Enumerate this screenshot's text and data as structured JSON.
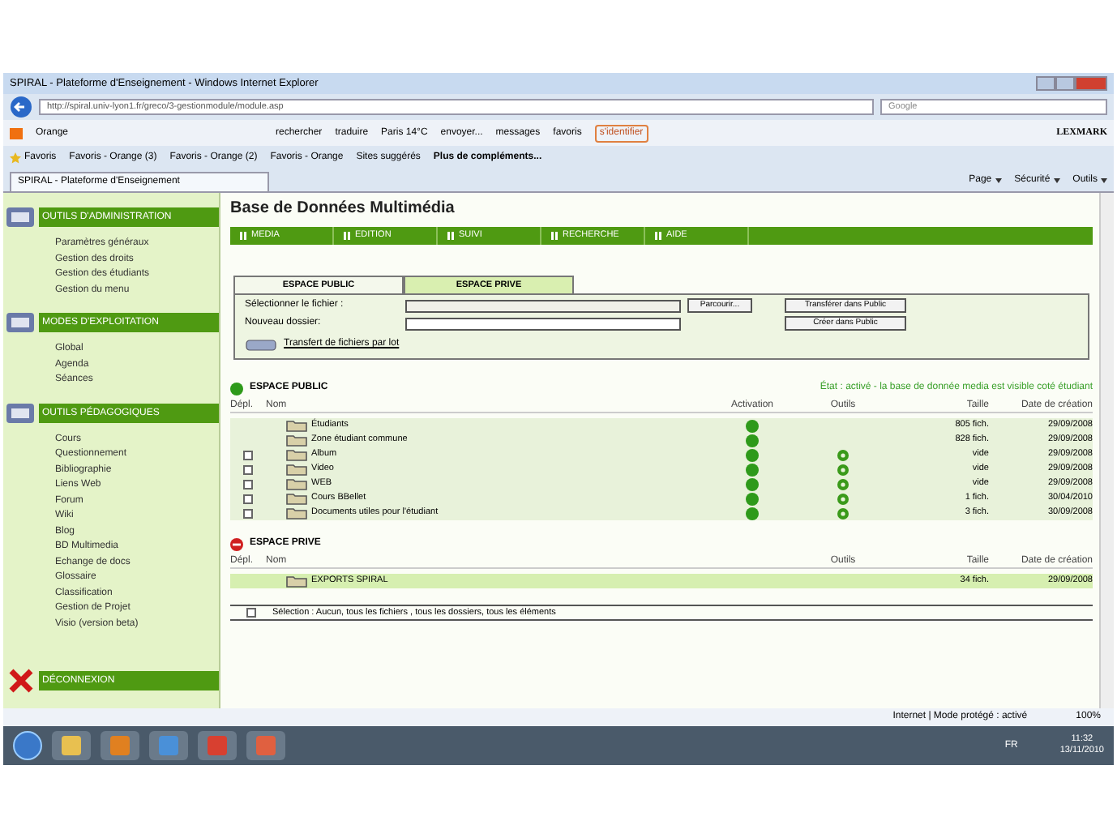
{
  "window": {
    "title": "SPIRAL - Plateforme d'Enseignement - Windows Internet Explorer"
  },
  "address_bar": {
    "url": "http://spiral.univ-lyon1.fr/greco/3-gestionmodule/module.asp",
    "search_placeholder": "Google"
  },
  "toolbar": {
    "brand": "Orange",
    "items": [
      "rechercher",
      "traduire",
      "Paris 14°C",
      "envoyer...",
      "messages",
      "favoris"
    ],
    "login": "s'identifier",
    "right_brand": "LEXMARK"
  },
  "favorites_bar": {
    "label": "Favoris",
    "items": [
      "Favoris - Orange (3)",
      "Favoris - Orange (2)",
      "Favoris - Orange",
      "Sites suggérés",
      "Plus de compléments..."
    ]
  },
  "browser_tab": {
    "title": "SPIRAL - Plateforme d'Enseignement"
  },
  "command_bar": [
    "Page",
    "Sécurité",
    "Outils"
  ],
  "sidebar": {
    "sections": [
      {
        "title": "OUTILS D'ADMINISTRATION",
        "items": [
          "Paramètres généraux",
          "Gestion des droits",
          "Gestion des étudiants",
          "Gestion du menu"
        ]
      },
      {
        "title": "MODES D'EXPLOITATION",
        "items": [
          "Global",
          "Agenda",
          "Séances"
        ]
      },
      {
        "title": "OUTILS PÉDAGOGIQUES",
        "items": [
          "Cours",
          "Questionnement",
          "Bibliographie",
          "Liens Web",
          "Forum",
          "Wiki",
          "Blog",
          "BD Multimedia",
          "Echange de docs",
          "Glossaire",
          "Classification",
          "Gestion de Projet",
          "Visio (version beta)"
        ]
      }
    ],
    "logout": "DÉCONNEXION"
  },
  "page": {
    "title": "Base de Données Multimédia",
    "menu": [
      "MEDIA",
      "EDITION",
      "SUIVI",
      "RECHERCHE",
      "AIDE"
    ]
  },
  "upload": {
    "tabs": [
      {
        "label": "ESPACE PUBLIC",
        "selected": true
      },
      {
        "label": "ESPACE PRIVE",
        "selected": false
      }
    ],
    "file_label": "Sélectionner le fichier :",
    "browse": "Parcourir...",
    "transfer": "Transférer dans Public",
    "folder_label": "Nouveau dossier:",
    "create": "Créer dans Public",
    "batch_link": "Transfert de fichiers par lot"
  },
  "public_space": {
    "title": "ESPACE PUBLIC",
    "state": "État : activé - la base de donnée media est visible coté étudiant",
    "columns": [
      "Dépl.",
      "Nom",
      "Activation",
      "Outils",
      "Taille",
      "Date de création"
    ],
    "rows": [
      {
        "movable": false,
        "name": "Étudiants",
        "active": true,
        "tools": false,
        "size": "805 fich.",
        "date": "29/09/2008"
      },
      {
        "movable": false,
        "name": "Zone étudiant commune",
        "active": true,
        "tools": false,
        "size": "828 fich.",
        "date": "29/09/2008"
      },
      {
        "movable": true,
        "name": "Album",
        "active": true,
        "tools": true,
        "size": "vide",
        "date": "29/09/2008"
      },
      {
        "movable": true,
        "name": "Video",
        "active": true,
        "tools": true,
        "size": "vide",
        "date": "29/09/2008"
      },
      {
        "movable": true,
        "name": "WEB",
        "active": true,
        "tools": true,
        "size": "vide",
        "date": "29/09/2008"
      },
      {
        "movable": true,
        "name": "Cours BBellet",
        "active": true,
        "tools": true,
        "size": "1 fich.",
        "date": "30/04/2010"
      },
      {
        "movable": true,
        "name": "Documents utiles pour l'étudiant",
        "active": true,
        "tools": true,
        "size": "3 fich.",
        "date": "30/09/2008"
      }
    ]
  },
  "private_space": {
    "title": "ESPACE PRIVE",
    "columns": [
      "Dépl.",
      "Nom",
      "Outils",
      "Taille",
      "Date de création"
    ],
    "rows": [
      {
        "name": "EXPORTS SPIRAL",
        "size": "34 fich.",
        "date": "29/09/2008"
      }
    ]
  },
  "selection": {
    "checked": false,
    "label": "Sélection",
    "options": ": Aucun, tous les fichiers , tous les dossiers, tous les éléments"
  },
  "status_bar": {
    "zone": "Internet | Mode protégé : activé",
    "zoom": "100%"
  },
  "taskbar": {
    "language": "FR",
    "time": "11:32",
    "date": "13/11/2010"
  }
}
